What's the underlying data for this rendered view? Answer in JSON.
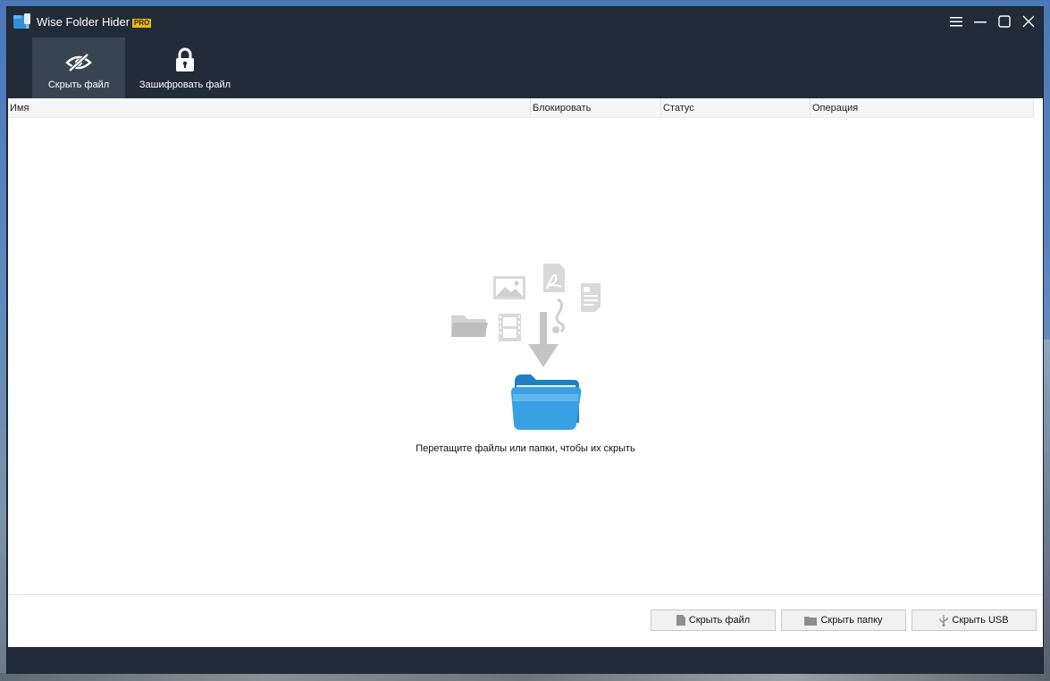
{
  "app": {
    "title": "Wise Folder Hider",
    "badge": "PRO"
  },
  "toolbar": {
    "hide_file_label": "Скрыть файл",
    "encrypt_file_label": "Зашифровать файл"
  },
  "table": {
    "columns": [
      "Имя",
      "Блокировать",
      "Статус",
      "Операция"
    ]
  },
  "drop_hint": "Перетащите файлы или папки, чтобы их скрыть",
  "actions": {
    "hide_file": "Скрыть файл",
    "hide_folder": "Скрыть папку",
    "hide_usb": "Скрыть USB"
  },
  "colors": {
    "title_bar": "#222b38",
    "accent_badge": "#f2b705",
    "active_tab": "#394452"
  }
}
